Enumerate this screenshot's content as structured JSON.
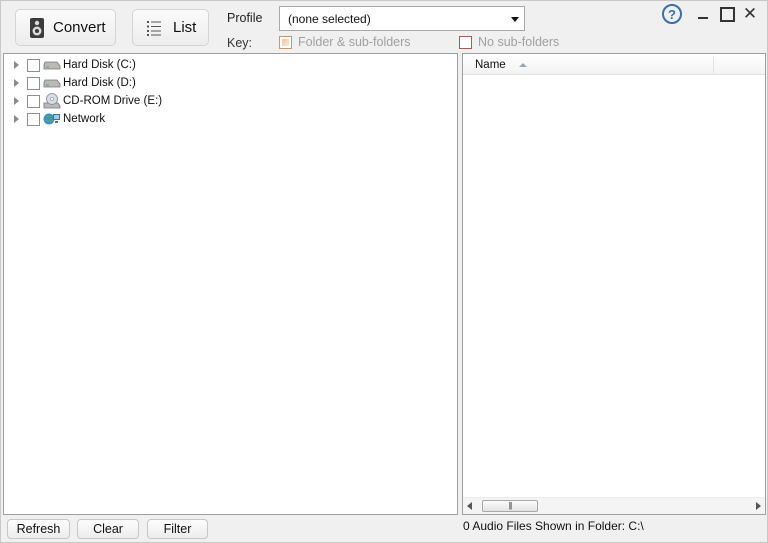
{
  "toolbar": {
    "convert_label": "Convert",
    "list_label": "List",
    "profile_label": "Profile",
    "profile_value": "(none selected)",
    "key_label": "Key:",
    "key_folder_label": "Folder & sub-folders",
    "key_nosub_label": "No sub-folders"
  },
  "window_controls": {
    "help_symbol": "?",
    "close_symbol": "✕"
  },
  "tree": {
    "items": [
      {
        "label": "Hard Disk (C:)",
        "icon": "hard-disk-icon"
      },
      {
        "label": "Hard Disk (D:)",
        "icon": "hard-disk-icon"
      },
      {
        "label": "CD-ROM Drive (E:)",
        "icon": "cdrom-icon"
      },
      {
        "label": "Network",
        "icon": "network-icon"
      }
    ]
  },
  "files": {
    "column_name": "Name",
    "scroll_grip": "|||"
  },
  "bottom": {
    "refresh_label": "Refresh",
    "clear_label": "Clear",
    "filter_label": "Filter",
    "status_text": "0 Audio Files Shown in Folder: C:\\"
  },
  "colors": {
    "key_folder": "#d8935a",
    "key_nosub": "#c0504d",
    "help_icon": "#3a6fa8"
  }
}
